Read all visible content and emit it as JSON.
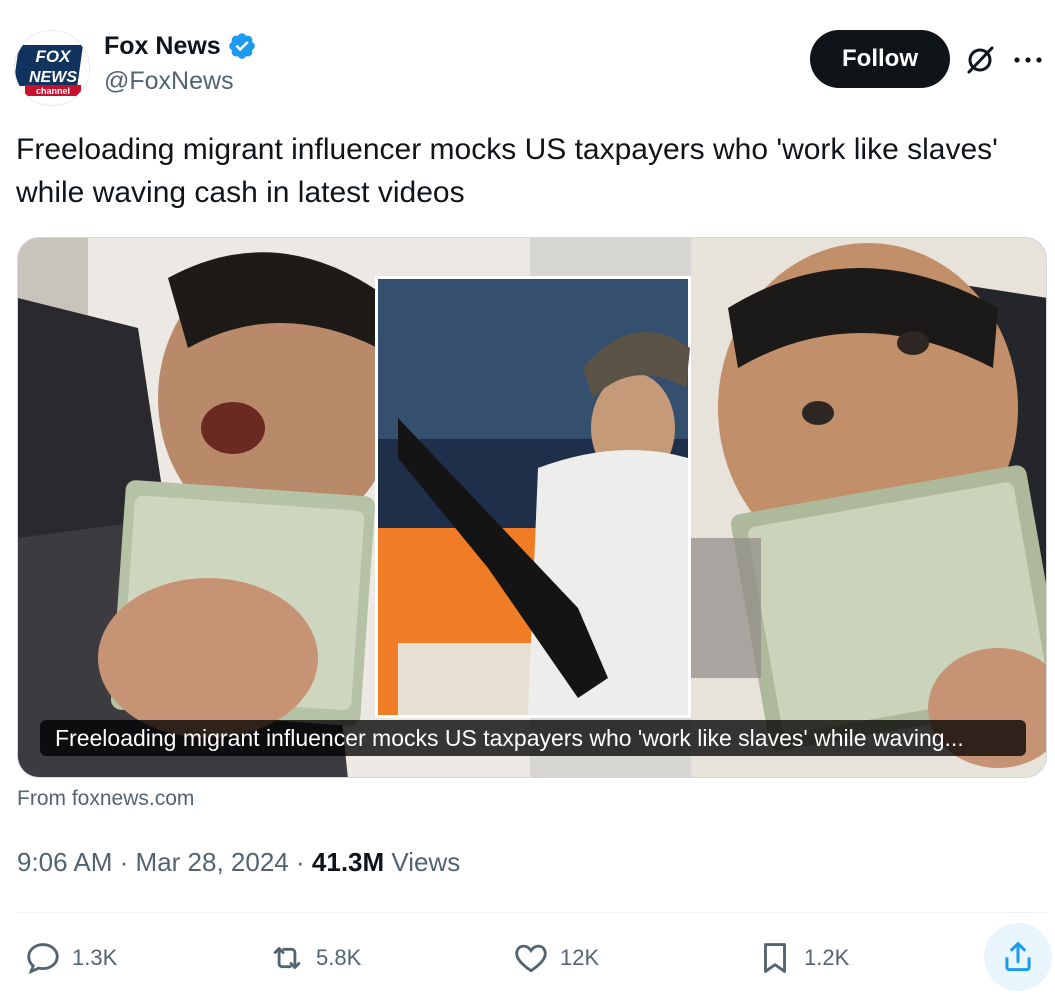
{
  "author": {
    "display_name": "Fox News",
    "handle": "@FoxNews",
    "avatar_logo_text": "FOX NEWS channel",
    "verified_icon": "verified-badge-icon"
  },
  "header": {
    "follow_label": "Follow",
    "grok_icon": "grok-icon",
    "more_icon": "more-icon"
  },
  "tweet": {
    "text": "Freeloading migrant influencer mocks US taxpayers who 'work like slaves' while waving cash in latest videos"
  },
  "card": {
    "caption": "Freeloading migrant influencer mocks US taxpayers who 'work like slaves' while waving...",
    "source": "From foxnews.com"
  },
  "meta": {
    "time": "9:06 AM",
    "separator": "·",
    "date": "Mar 28, 2024",
    "views_count": "41.3M",
    "views_label": "Views"
  },
  "actions": {
    "replies": "1.3K",
    "reposts": "5.8K",
    "likes": "12K",
    "bookmarks": "1.2K"
  },
  "colors": {
    "accent": "#1d9bf0",
    "text": "#0f1419",
    "secondary": "#536471",
    "follow_bg": "#0f1419"
  }
}
